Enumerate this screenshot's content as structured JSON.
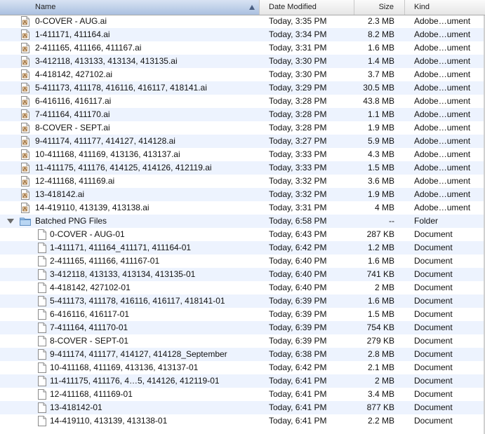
{
  "columns": {
    "name": "Name",
    "date": "Date Modified",
    "size": "Size",
    "kind": "Kind"
  },
  "rows": [
    {
      "name": "0-COVER - AUG.ai",
      "date": "Today, 3:35 PM",
      "size": "2.3 MB",
      "kind": "Adobe…ument",
      "type": "ai",
      "icon": "illustrator-file-icon"
    },
    {
      "name": "1-411171, 411164.ai",
      "date": "Today, 3:34 PM",
      "size": "8.2 MB",
      "kind": "Adobe…ument",
      "type": "ai",
      "icon": "illustrator-file-icon"
    },
    {
      "name": "2-411165, 411166, 411167.ai",
      "date": "Today, 3:31 PM",
      "size": "1.6 MB",
      "kind": "Adobe…ument",
      "type": "ai",
      "icon": "illustrator-file-icon"
    },
    {
      "name": "3-412118, 413133, 413134, 413135.ai",
      "date": "Today, 3:30 PM",
      "size": "1.4 MB",
      "kind": "Adobe…ument",
      "type": "ai",
      "icon": "illustrator-file-icon"
    },
    {
      "name": "4-418142, 427102.ai",
      "date": "Today, 3:30 PM",
      "size": "3.7 MB",
      "kind": "Adobe…ument",
      "type": "ai",
      "icon": "illustrator-file-icon"
    },
    {
      "name": "5-411173, 411178, 416116, 416117, 418141.ai",
      "date": "Today, 3:29 PM",
      "size": "30.5 MB",
      "kind": "Adobe…ument",
      "type": "ai",
      "icon": "illustrator-file-icon"
    },
    {
      "name": "6-416116, 416117.ai",
      "date": "Today, 3:28 PM",
      "size": "43.8 MB",
      "kind": "Adobe…ument",
      "type": "ai",
      "icon": "illustrator-file-icon"
    },
    {
      "name": "7-411164, 411170.ai",
      "date": "Today, 3:28 PM",
      "size": "1.1 MB",
      "kind": "Adobe…ument",
      "type": "ai",
      "icon": "illustrator-file-icon"
    },
    {
      "name": "8-COVER - SEPT.ai",
      "date": "Today, 3:28 PM",
      "size": "1.9 MB",
      "kind": "Adobe…ument",
      "type": "ai",
      "icon": "illustrator-file-icon"
    },
    {
      "name": "9-411174, 411177, 414127, 414128.ai",
      "date": "Today, 3:27 PM",
      "size": "5.9 MB",
      "kind": "Adobe…ument",
      "type": "ai",
      "icon": "illustrator-file-icon"
    },
    {
      "name": "10-411168, 411169, 413136, 413137.ai",
      "date": "Today, 3:33 PM",
      "size": "4.3 MB",
      "kind": "Adobe…ument",
      "type": "ai",
      "icon": "illustrator-file-icon"
    },
    {
      "name": "11-411175, 411176, 414125, 414126, 412119.ai",
      "date": "Today, 3:33 PM",
      "size": "1.5 MB",
      "kind": "Adobe…ument",
      "type": "ai",
      "icon": "illustrator-file-icon"
    },
    {
      "name": "12-411168, 411169.ai",
      "date": "Today, 3:32 PM",
      "size": "3.6 MB",
      "kind": "Adobe…ument",
      "type": "ai",
      "icon": "illustrator-file-icon"
    },
    {
      "name": "13-418142.ai",
      "date": "Today, 3:32 PM",
      "size": "1.9 MB",
      "kind": "Adobe…ument",
      "type": "ai",
      "icon": "illustrator-file-icon"
    },
    {
      "name": "14-419110, 413139, 413138.ai",
      "date": "Today, 3:31 PM",
      "size": "4 MB",
      "kind": "Adobe…ument",
      "type": "ai",
      "icon": "illustrator-file-icon"
    },
    {
      "name": "Batched PNG Files",
      "date": "Today, 6:58 PM",
      "size": "--",
      "kind": "Folder",
      "type": "folder",
      "icon": "folder-icon",
      "expanded": true
    },
    {
      "name": "0-COVER - AUG-01",
      "date": "Today, 6:43 PM",
      "size": "287 KB",
      "kind": "Document",
      "type": "doc",
      "icon": "document-icon"
    },
    {
      "name": "1-411171, 411164_411171, 411164-01",
      "date": "Today, 6:42 PM",
      "size": "1.2 MB",
      "kind": "Document",
      "type": "doc",
      "icon": "document-icon"
    },
    {
      "name": "2-411165, 411166, 411167-01",
      "date": "Today, 6:40 PM",
      "size": "1.6 MB",
      "kind": "Document",
      "type": "doc",
      "icon": "document-icon"
    },
    {
      "name": "3-412118, 413133, 413134, 413135-01",
      "date": "Today, 6:40 PM",
      "size": "741 KB",
      "kind": "Document",
      "type": "doc",
      "icon": "document-icon"
    },
    {
      "name": "4-418142, 427102-01",
      "date": "Today, 6:40 PM",
      "size": "2 MB",
      "kind": "Document",
      "type": "doc",
      "icon": "document-icon"
    },
    {
      "name": "5-411173, 411178, 416116, 416117, 418141-01",
      "date": "Today, 6:39 PM",
      "size": "1.6 MB",
      "kind": "Document",
      "type": "doc",
      "icon": "document-icon"
    },
    {
      "name": "6-416116, 416117-01",
      "date": "Today, 6:39 PM",
      "size": "1.5 MB",
      "kind": "Document",
      "type": "doc",
      "icon": "document-icon"
    },
    {
      "name": "7-411164, 411170-01",
      "date": "Today, 6:39 PM",
      "size": "754 KB",
      "kind": "Document",
      "type": "doc",
      "icon": "document-icon"
    },
    {
      "name": "8-COVER - SEPT-01",
      "date": "Today, 6:39 PM",
      "size": "279 KB",
      "kind": "Document",
      "type": "doc",
      "icon": "document-icon"
    },
    {
      "name": "9-411174, 411177, 414127, 414128_September",
      "date": "Today, 6:38 PM",
      "size": "2.8 MB",
      "kind": "Document",
      "type": "doc",
      "icon": "document-icon"
    },
    {
      "name": "10-411168, 411169, 413136, 413137-01",
      "date": "Today, 6:42 PM",
      "size": "2.1 MB",
      "kind": "Document",
      "type": "doc",
      "icon": "document-icon"
    },
    {
      "name": "11-411175, 411176, 4…5, 414126, 412119-01",
      "date": "Today, 6:41 PM",
      "size": "2 MB",
      "kind": "Document",
      "type": "doc",
      "icon": "document-icon"
    },
    {
      "name": "12-411168, 411169-01",
      "date": "Today, 6:41 PM",
      "size": "3.4 MB",
      "kind": "Document",
      "type": "doc",
      "icon": "document-icon"
    },
    {
      "name": "13-418142-01",
      "date": "Today, 6:41 PM",
      "size": "877 KB",
      "kind": "Document",
      "type": "doc",
      "icon": "document-icon"
    },
    {
      "name": "14-419110, 413139, 413138-01",
      "date": "Today, 6:41 PM",
      "size": "2.2 MB",
      "kind": "Document",
      "type": "doc",
      "icon": "document-icon"
    }
  ]
}
